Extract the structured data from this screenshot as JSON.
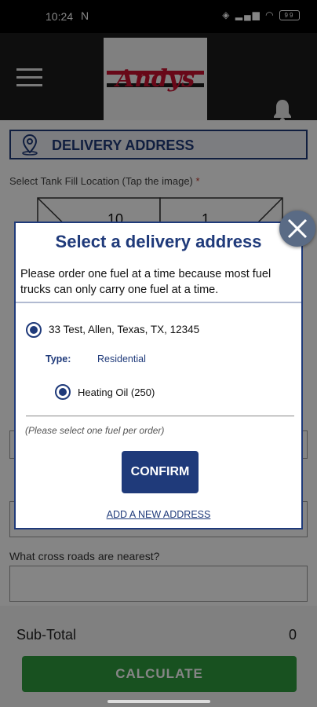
{
  "status_bar": {
    "time": "10:24",
    "notif_icon": "N",
    "battery": "99"
  },
  "app_bar": {
    "logo_text": "Andys"
  },
  "delivery_section": {
    "title": "DELIVERY ADDRESS"
  },
  "tank": {
    "label": "Select Tank Fill Location (Tap the image)",
    "required_mark": "*",
    "cells": [
      "10",
      "1"
    ]
  },
  "form": {
    "crossroads_label": "What cross roads are nearest?"
  },
  "totals": {
    "subtotal_label": "Sub-Total",
    "subtotal_value": "0",
    "calculate_label": "CALCULATE"
  },
  "dialog": {
    "title": "Select a delivery address",
    "note": "Please order one fuel at a time because most fuel trucks can only carry one fuel at a time.",
    "address": "33 Test, Allen, Texas, TX, 12345",
    "type_label": "Type:",
    "type_value": "Residential",
    "fuel": "Heating Oil (250)",
    "hint": "(Please select one fuel per order)",
    "confirm_label": "CONFIRM",
    "add_address_label": "ADD A NEW ADDRESS"
  },
  "colors": {
    "primary": "#1f3a7a",
    "calculate": "#2e9b3f",
    "logo_red": "#c8102e",
    "appbar": "#1b1b1b"
  }
}
